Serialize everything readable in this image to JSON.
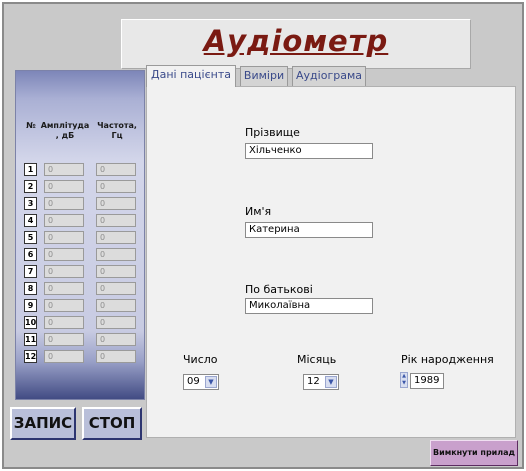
{
  "window": {
    "title": "Аудіометр"
  },
  "panel": {
    "headers": {
      "num": "№",
      "amp": "Амплітуда , дБ",
      "freq": "Частота, Гц"
    },
    "rows": [
      {
        "num": "1",
        "amp": "0",
        "freq": "0"
      },
      {
        "num": "2",
        "amp": "0",
        "freq": "0"
      },
      {
        "num": "3",
        "amp": "0",
        "freq": "0"
      },
      {
        "num": "4",
        "amp": "0",
        "freq": "0"
      },
      {
        "num": "5",
        "amp": "0",
        "freq": "0"
      },
      {
        "num": "6",
        "amp": "0",
        "freq": "0"
      },
      {
        "num": "7",
        "amp": "0",
        "freq": "0"
      },
      {
        "num": "8",
        "amp": "0",
        "freq": "0"
      },
      {
        "num": "9",
        "amp": "0",
        "freq": "0"
      },
      {
        "num": "10",
        "amp": "0",
        "freq": "0"
      },
      {
        "num": "11",
        "amp": "0",
        "freq": "0"
      },
      {
        "num": "12",
        "amp": "0",
        "freq": "0"
      }
    ]
  },
  "buttons": {
    "record": "ЗАПИС",
    "stop": "СТОП",
    "power_off": "Вимкнути прилад"
  },
  "tabs": [
    {
      "label": "Дані пацієнта",
      "active": true
    },
    {
      "label": "Виміри",
      "active": false
    },
    {
      "label": "Аудіограма",
      "active": false
    }
  ],
  "patient": {
    "surname_label": "Прізвище",
    "surname_value": "Хільченко",
    "name_label": "Им'я",
    "name_value": "Катерина",
    "patronymic_label": "По батькові",
    "patronymic_value": "Миколаївна",
    "day_label": "Число",
    "day_value": "09",
    "month_label": "Місяць",
    "month_value": "12",
    "year_label": "Рік народження",
    "year_value": "1989"
  },
  "icons": {
    "dropdown": "chevron-down-icon",
    "spinner": "spinner-icon"
  }
}
